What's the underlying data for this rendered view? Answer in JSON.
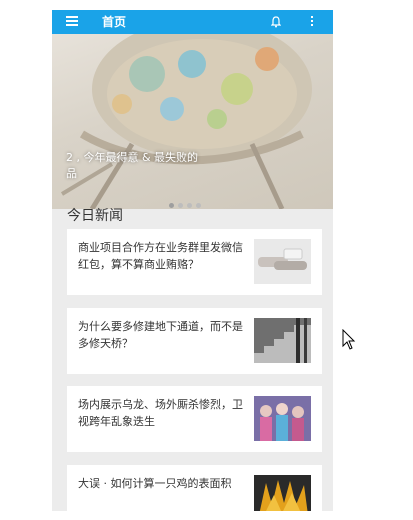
{
  "app_bar": {
    "title": "首页",
    "menu_icon": "menu-icon",
    "notification_icon": "bell-icon",
    "overflow_icon": "more-vert-icon",
    "color": "#1aa3e8"
  },
  "banner": {
    "caption": "2                    , 今年最得意 & 最失败的\n品",
    "dot_count": 4,
    "active_dot": 0
  },
  "news": {
    "section_title": "今日新闻",
    "items": [
      {
        "title": "商业项目合作方在业务群里发微信红包，算不算商业贿赂？",
        "thumb_icon": "handshake-photo"
      },
      {
        "title": "为什么要多修建地下通道，而不是多修天桥？",
        "thumb_icon": "stairs-photo"
      },
      {
        "title": "场内展示乌龙、场外厮杀惨烈，卫视跨年乱象迭生",
        "thumb_icon": "stage-photo"
      },
      {
        "title": "大误 · 如何计算一只鸡的表面积",
        "thumb_icon": "chicken-photo"
      }
    ]
  }
}
